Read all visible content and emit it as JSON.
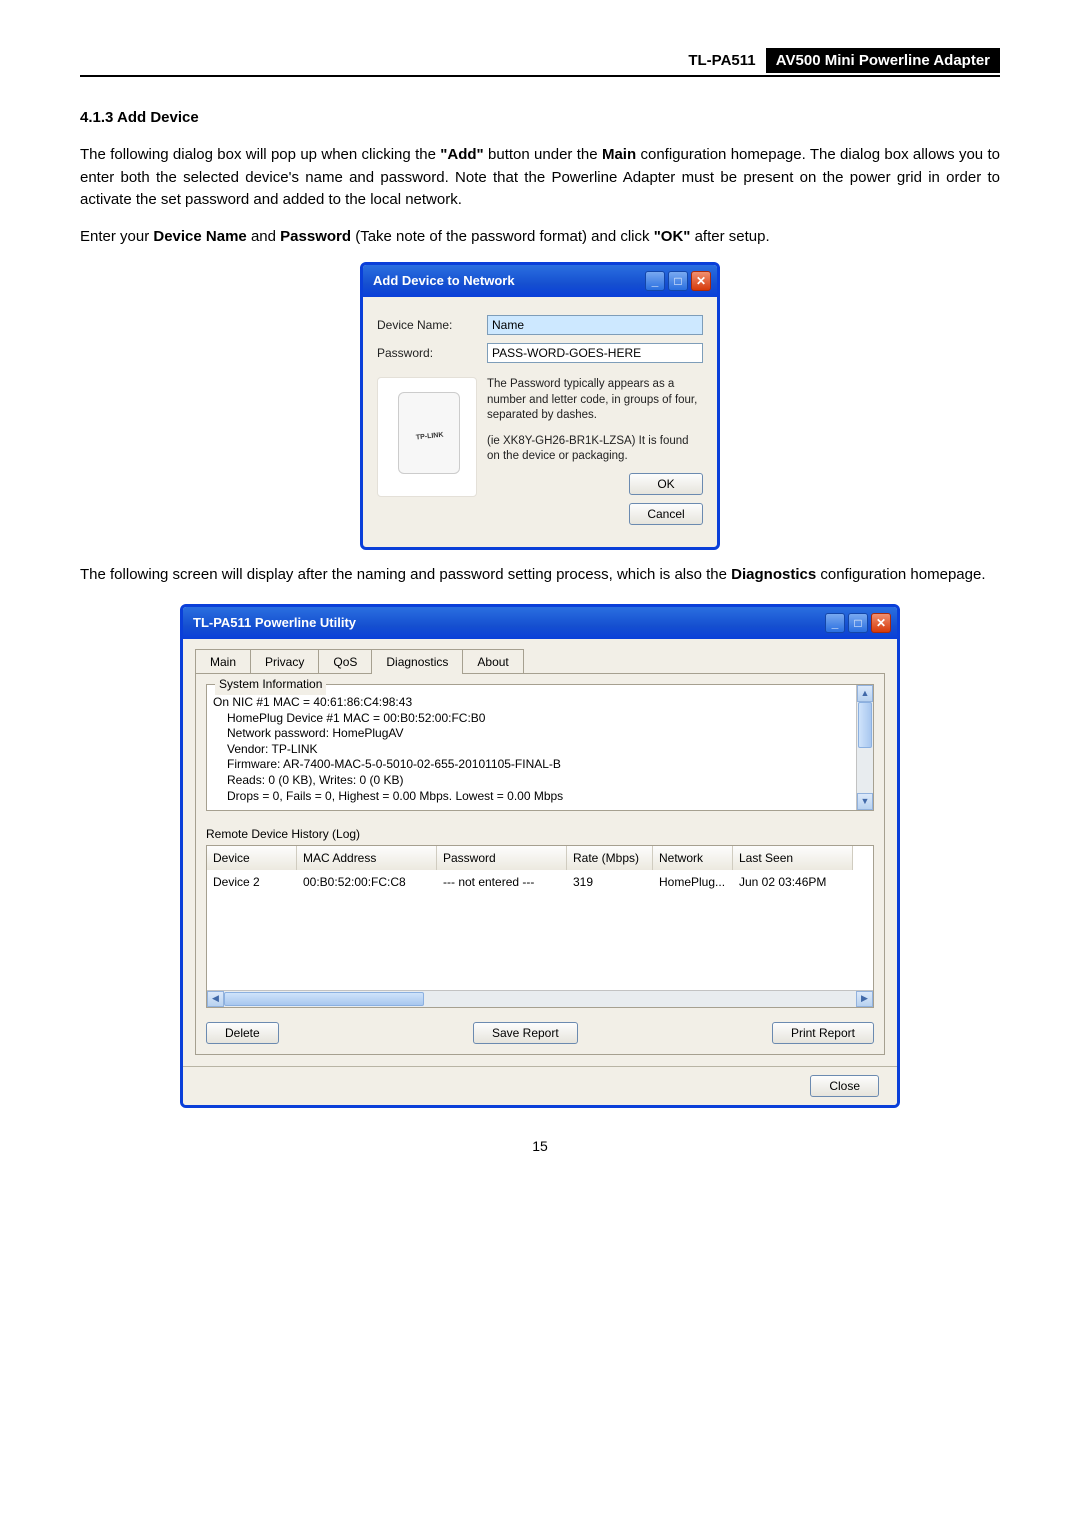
{
  "header": {
    "model": "TL-PA511",
    "product": "AV500 Mini Powerline Adapter"
  },
  "section": {
    "number": "4.1.3",
    "title": "Add Device"
  },
  "para1_pre": "The following dialog box will pop up when clicking the ",
  "para1_add": "\"Add\"",
  "para1_mid": " button under the ",
  "para1_main": "Main",
  "para1_post": " configuration homepage. The dialog box allows you to enter both the selected device's name and password. Note that the Powerline Adapter must be present on the power grid in order to activate the set password and added to the local network.",
  "para2_pre": "Enter your ",
  "para2_dn": "Device Name",
  "para2_mid1": " and ",
  "para2_pw": "Password",
  "para2_mid2": " (Take note of the password format) and click ",
  "para2_ok": "\"OK\"",
  "para2_post": " after setup.",
  "add_dialog": {
    "title": "Add Device to Network",
    "device_name_label": "Device Name:",
    "device_name_value": "Name",
    "password_label": "Password:",
    "password_value": "PASS-WORD-GOES-HERE",
    "hint1": "The Password typically appears as a number and letter code, in groups of four, separated by dashes.",
    "hint2": "(ie XK8Y-GH26-BR1K-LZSA) It is found on the device or packaging.",
    "ok": "OK",
    "cancel": "Cancel"
  },
  "para3_pre": "The following screen will display after the naming and password setting process, which is also the ",
  "para3_diag": "Diagnostics",
  "para3_post": " configuration homepage.",
  "utility": {
    "title": "TL-PA511 Powerline Utility",
    "tabs": {
      "main": "Main",
      "privacy": "Privacy",
      "qos": "QoS",
      "diagnostics": "Diagnostics",
      "about": "About"
    },
    "sysinfo_title": "System Information",
    "sysinfo_lines": {
      "l1": "On NIC #1 MAC = 40:61:86:C4:98:43",
      "l2": "HomePlug Device #1 MAC = 00:B0:52:00:FC:B0",
      "l3": "Network password: HomePlugAV",
      "l4": "Vendor: TP-LINK",
      "l5": "Firmware: AR-7400-MAC-5-0-5010-02-655-20101105-FINAL-B",
      "l6": "Reads: 0 (0 KB), Writes: 0 (0 KB)",
      "l7": "Drops = 0, Fails = 0, Highest = 0.00 Mbps. Lowest = 0.00 Mbps"
    },
    "history_label": "Remote Device History (Log)",
    "columns": {
      "device": "Device",
      "mac": "MAC Address",
      "password": "Password",
      "rate": "Rate (Mbps)",
      "network": "Network",
      "last_seen": "Last Seen"
    },
    "row": {
      "device": "Device 2",
      "mac": "00:B0:52:00:FC:C8",
      "password": "--- not entered ---",
      "rate": "319",
      "network": "HomePlug...",
      "last_seen": "Jun 02 03:46PM"
    },
    "delete": "Delete",
    "save_report": "Save Report",
    "print_report": "Print Report",
    "close": "Close"
  },
  "page_number": "15"
}
